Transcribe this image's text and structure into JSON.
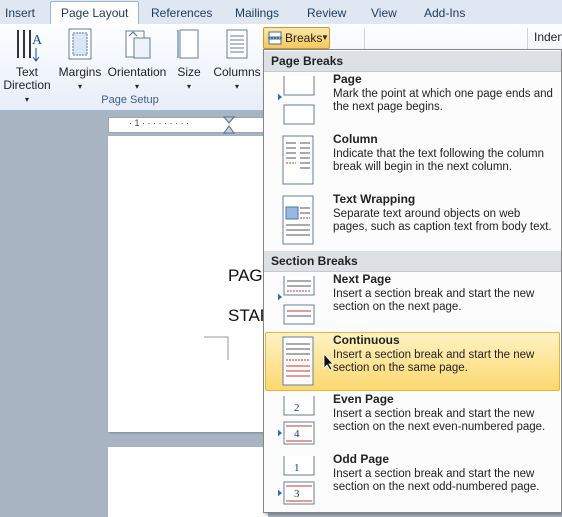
{
  "tabs": [
    "Insert",
    "Page Layout",
    "References",
    "Mailings",
    "Review",
    "View",
    "Add-Ins"
  ],
  "ribbon": {
    "text_direction": [
      "Text",
      "Direction"
    ],
    "margins": "Margins",
    "orientation": "Orientation",
    "size": "Size",
    "columns": "Columns",
    "breaks": "Breaks",
    "group_label": "Page Setup",
    "indent_partial": "Inden"
  },
  "document": {
    "line1": "PAG",
    "line2": "STAR"
  },
  "menu": {
    "page_breaks_header": "Page Breaks",
    "section_breaks_header": "Section Breaks",
    "items": [
      {
        "title": "Page",
        "desc": "Mark the point at which one page ends and the next page begins."
      },
      {
        "title": "Column",
        "desc": "Indicate that the text following the column break will begin in the next column."
      },
      {
        "title": "Text Wrapping",
        "desc": "Separate text around objects on web pages, such as caption text from body text."
      },
      {
        "title": "Next Page",
        "desc": "Insert a section break and start the new section on the next page."
      },
      {
        "title": "Continuous",
        "desc": "Insert a section break and start the new section on the same page."
      },
      {
        "title": "Even Page",
        "desc": "Insert a section break and start the new section on the next even-numbered page."
      },
      {
        "title": "Odd Page",
        "desc": "Insert a section break and start the new section on the next odd-numbered page."
      }
    ]
  },
  "colors": {
    "highlight": "#fcd86f",
    "accent": "#c0392b"
  }
}
